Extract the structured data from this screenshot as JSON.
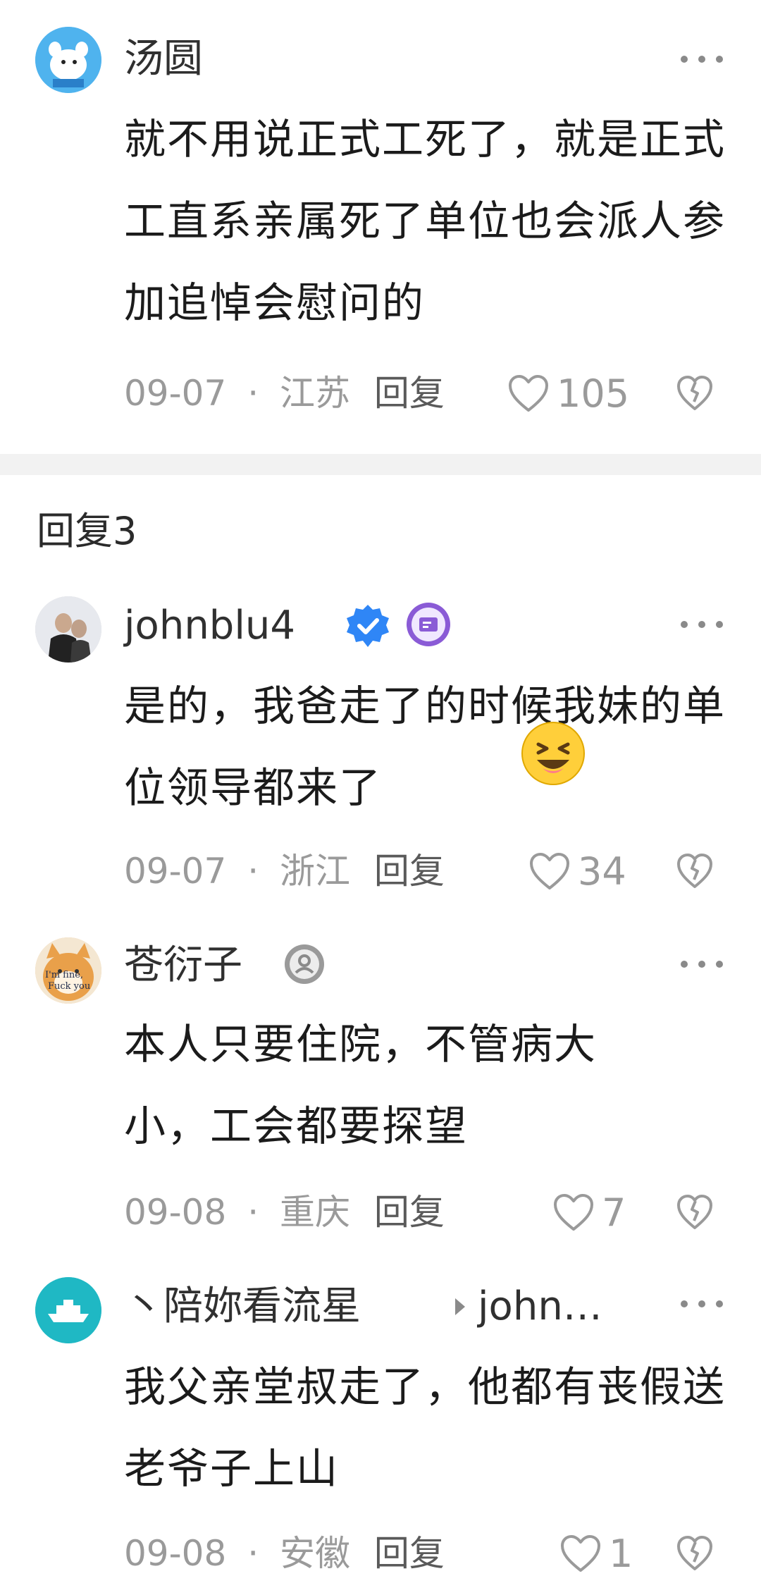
{
  "comments": {
    "c1": {
      "name": "汤圆",
      "text": "就不用说正式工死了，就是正式工直系亲属死了单位也会派人参加追悼会慰问的",
      "date": "09-07",
      "location": "江苏",
      "reply_label": "回复",
      "likes": "105"
    },
    "section_title": "回复3",
    "c2": {
      "name": "johnblu4",
      "text": "是的，我爸走了的时候我妹的单位领导都来了",
      "date": "09-07",
      "location": "浙江",
      "reply_label": "回复",
      "likes": "34"
    },
    "c3": {
      "name": "苍衍子",
      "text": "本人只要住院，不管病大小，工会都要探望",
      "date": "09-08",
      "location": "重庆",
      "reply_label": "回复",
      "likes": "7",
      "avatar_text_1": "I'm fine,",
      "avatar_text_2": "Fuck you"
    },
    "c4": {
      "name": "丶陪妳看流星",
      "reply_to": "john…",
      "text": "我父亲堂叔走了，他都有丧假送老爷子上山",
      "date": "09-08",
      "location": "安徽",
      "reply_label": "回复",
      "likes": "1"
    }
  },
  "meta_separator": "·",
  "icons": [
    "more-icon",
    "heart-icon",
    "dislike-icon",
    "verified-icon",
    "vip-badge-icon",
    "level-badge-icon",
    "laughing-emoji",
    "reply-arrow-icon"
  ],
  "colors": {
    "verified": "#2f86f6",
    "purple_badge": "#8a5bd6",
    "teal_avatar": "#1fb8c4",
    "light_blue_avatar": "#4fb3ee"
  }
}
